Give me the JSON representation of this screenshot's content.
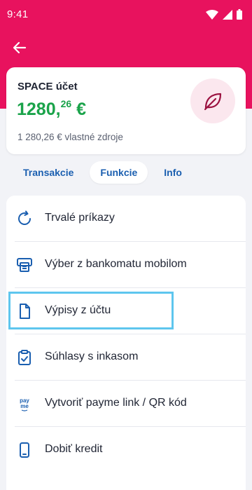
{
  "status_bar": {
    "time": "9:41"
  },
  "account": {
    "name": "SPACE účet",
    "balance_main": "1280,",
    "balance_decimals": "26",
    "balance_currency": "€",
    "own_funds": "1 280,26 € vlastné zdroje",
    "icon": "leaf-icon"
  },
  "tabs": [
    {
      "label": "Transakcie",
      "active": false
    },
    {
      "label": "Funkcie",
      "active": true
    },
    {
      "label": "Info",
      "active": false
    }
  ],
  "menu": [
    {
      "label": "Trvalé príkazy",
      "icon": "refresh-icon"
    },
    {
      "label": "Výber z bankomatu mobilom",
      "icon": "atm-icon"
    },
    {
      "label": "Výpisy z účtu",
      "icon": "document-icon",
      "highlighted": true
    },
    {
      "label": "Súhlasy s inkasom",
      "icon": "clipboard-check-icon"
    },
    {
      "label": "Vytvoriť payme link / QR kód",
      "icon": "payme-icon",
      "icon_text": "pay me"
    },
    {
      "label": "Dobiť kredit",
      "icon": "phone-icon"
    }
  ],
  "colors": {
    "brand": "#e8125e",
    "balance": "#1aa34a",
    "link": "#1b5fb0",
    "highlight": "#5ec6ee",
    "background": "#f2f3f7"
  }
}
